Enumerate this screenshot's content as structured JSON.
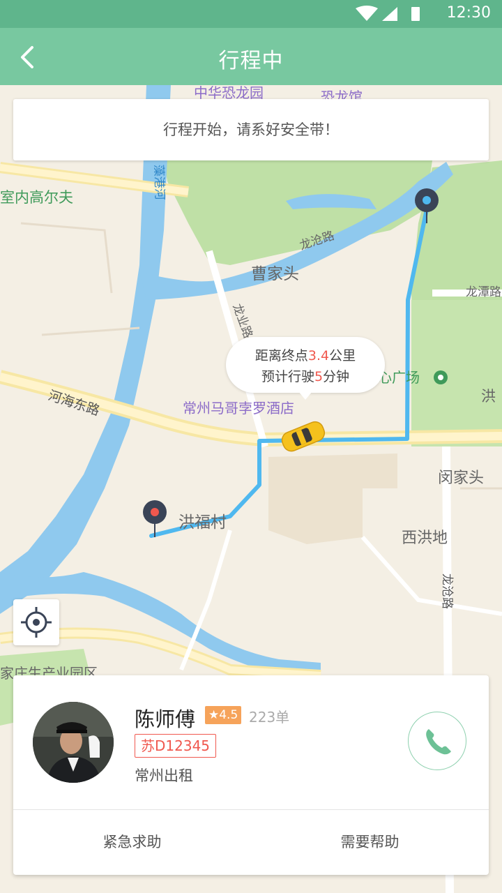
{
  "status_bar": {
    "time": "12:30"
  },
  "app_bar": {
    "title": "行程中"
  },
  "notice": {
    "text": "行程开始，请系好安全带！"
  },
  "trip_bubble": {
    "line1_prefix": "距离终点",
    "distance_value": "3.4",
    "line1_suffix": "公里",
    "line2_prefix": "预计行驶",
    "time_value": "5",
    "line2_suffix": "分钟"
  },
  "map_labels": {
    "park": "中华恐龙园",
    "museum": "恐龙馆",
    "golf": "室内高尔夫",
    "river": "藻港河",
    "longcang_road": "龙沧路",
    "caojiatou": "曹家头",
    "longtan_road": "龙潭路",
    "longye_road": "龙业路",
    "square": "心广场",
    "hong": "洪",
    "hehai_road": "河海东路",
    "hotel": "常州马哥孛罗酒店",
    "minjiatou": "闵家头",
    "hongfucun": "洪福村",
    "xihongdi": "西洪地",
    "longcang_road2": "龙沧路",
    "industrial_park": "家庄生产业园区"
  },
  "driver": {
    "name": "陈师傅",
    "rating": "★4.5",
    "orders": "223单",
    "plate": "苏D12345",
    "company": "常州出租"
  },
  "actions": {
    "emergency": "紧急求助",
    "help": "需要帮助"
  },
  "colors": {
    "status_bar": "#5fb58c",
    "app_bar": "#78c8a0",
    "route": "#4fb8ef",
    "highlight": "#f0584e",
    "rating_badge": "#f6a35a"
  },
  "icons": {
    "back": "chevron-left-icon",
    "locate": "crosshair-icon",
    "call": "phone-icon",
    "car": "taxi-icon",
    "start_pin": "start-pin-icon",
    "end_pin": "end-pin-icon"
  }
}
